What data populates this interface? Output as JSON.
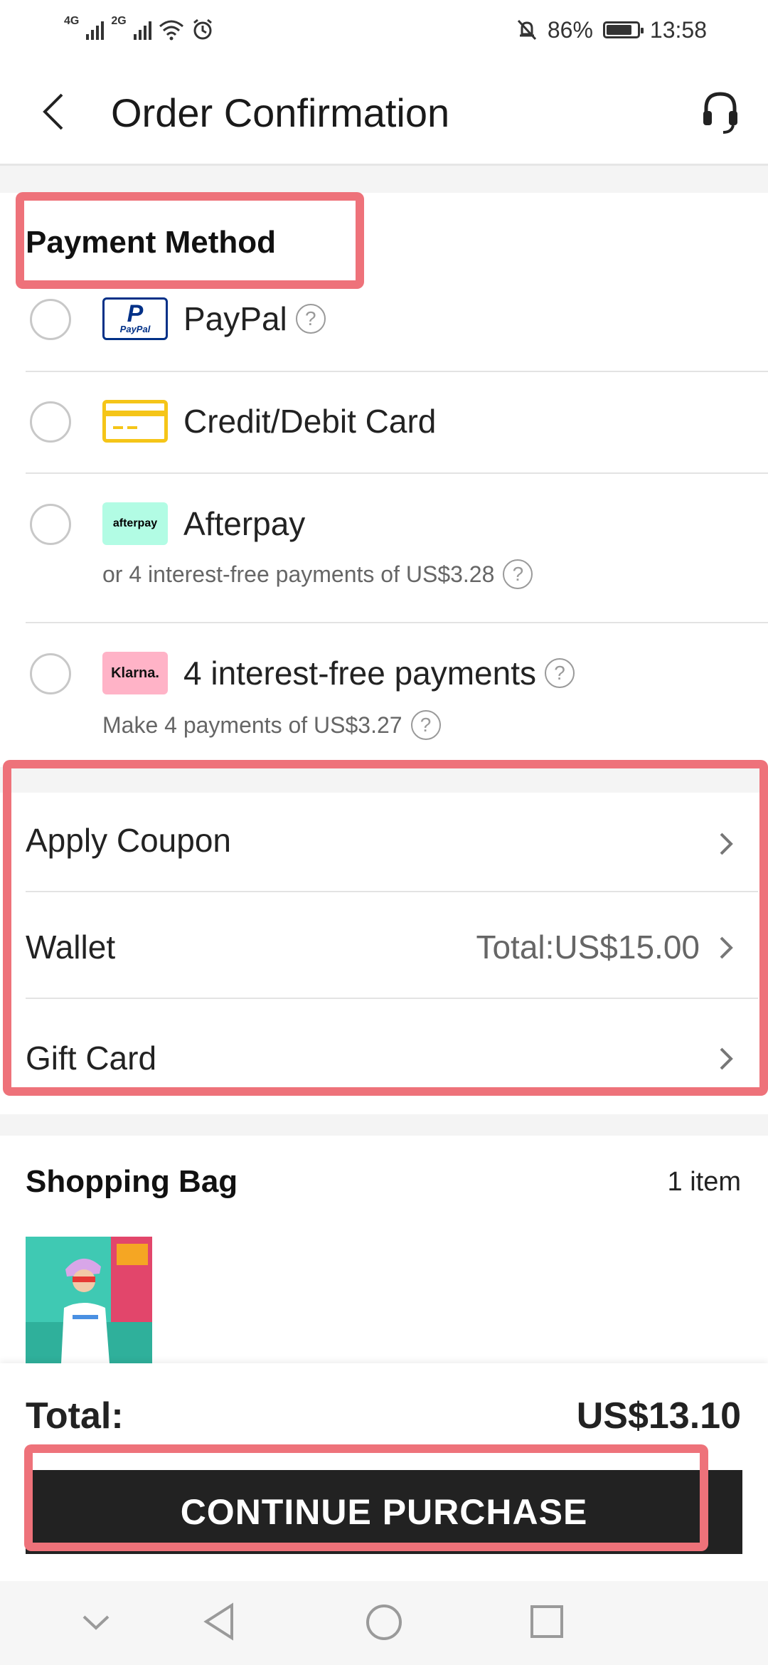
{
  "status_bar": {
    "net1": "4G",
    "net2": "2G",
    "battery": "86%",
    "battery_level": 0.86,
    "time": "13:58"
  },
  "header": {
    "title": "Order Confirmation"
  },
  "payment": {
    "title": "Payment Method",
    "methods": [
      {
        "label": "PayPal",
        "logo_text": "PayPal",
        "icon": "paypal-icon"
      },
      {
        "label": "Credit/Debit Card",
        "icon": "credit-card-icon"
      },
      {
        "label": "Afterpay",
        "logo_text": "afterpay",
        "sub": "or 4 interest-free payments of US$3.28",
        "icon": "afterpay-icon"
      },
      {
        "label": "4 interest-free payments",
        "logo_text": "Klarna.",
        "sub": "Make 4 payments of US$3.27",
        "icon": "klarna-icon"
      }
    ],
    "help_glyph": "?"
  },
  "options": {
    "coupon_label": "Apply Coupon",
    "wallet_label": "Wallet",
    "wallet_value": "Total:US$15.00",
    "gift_label": "Gift Card"
  },
  "bag": {
    "title": "Shopping Bag",
    "count": "1 item"
  },
  "summary": {
    "total_label": "Total:",
    "total_value": "US$13.10",
    "cta_label": "CONTINUE PURCHASE"
  },
  "colors": {
    "highlight": "#ee727a",
    "cta_bg": "#222222",
    "afterpay": "#b2fce4",
    "klarna": "#ffb3c7",
    "card": "#f5c518",
    "paypal": "#003087"
  }
}
